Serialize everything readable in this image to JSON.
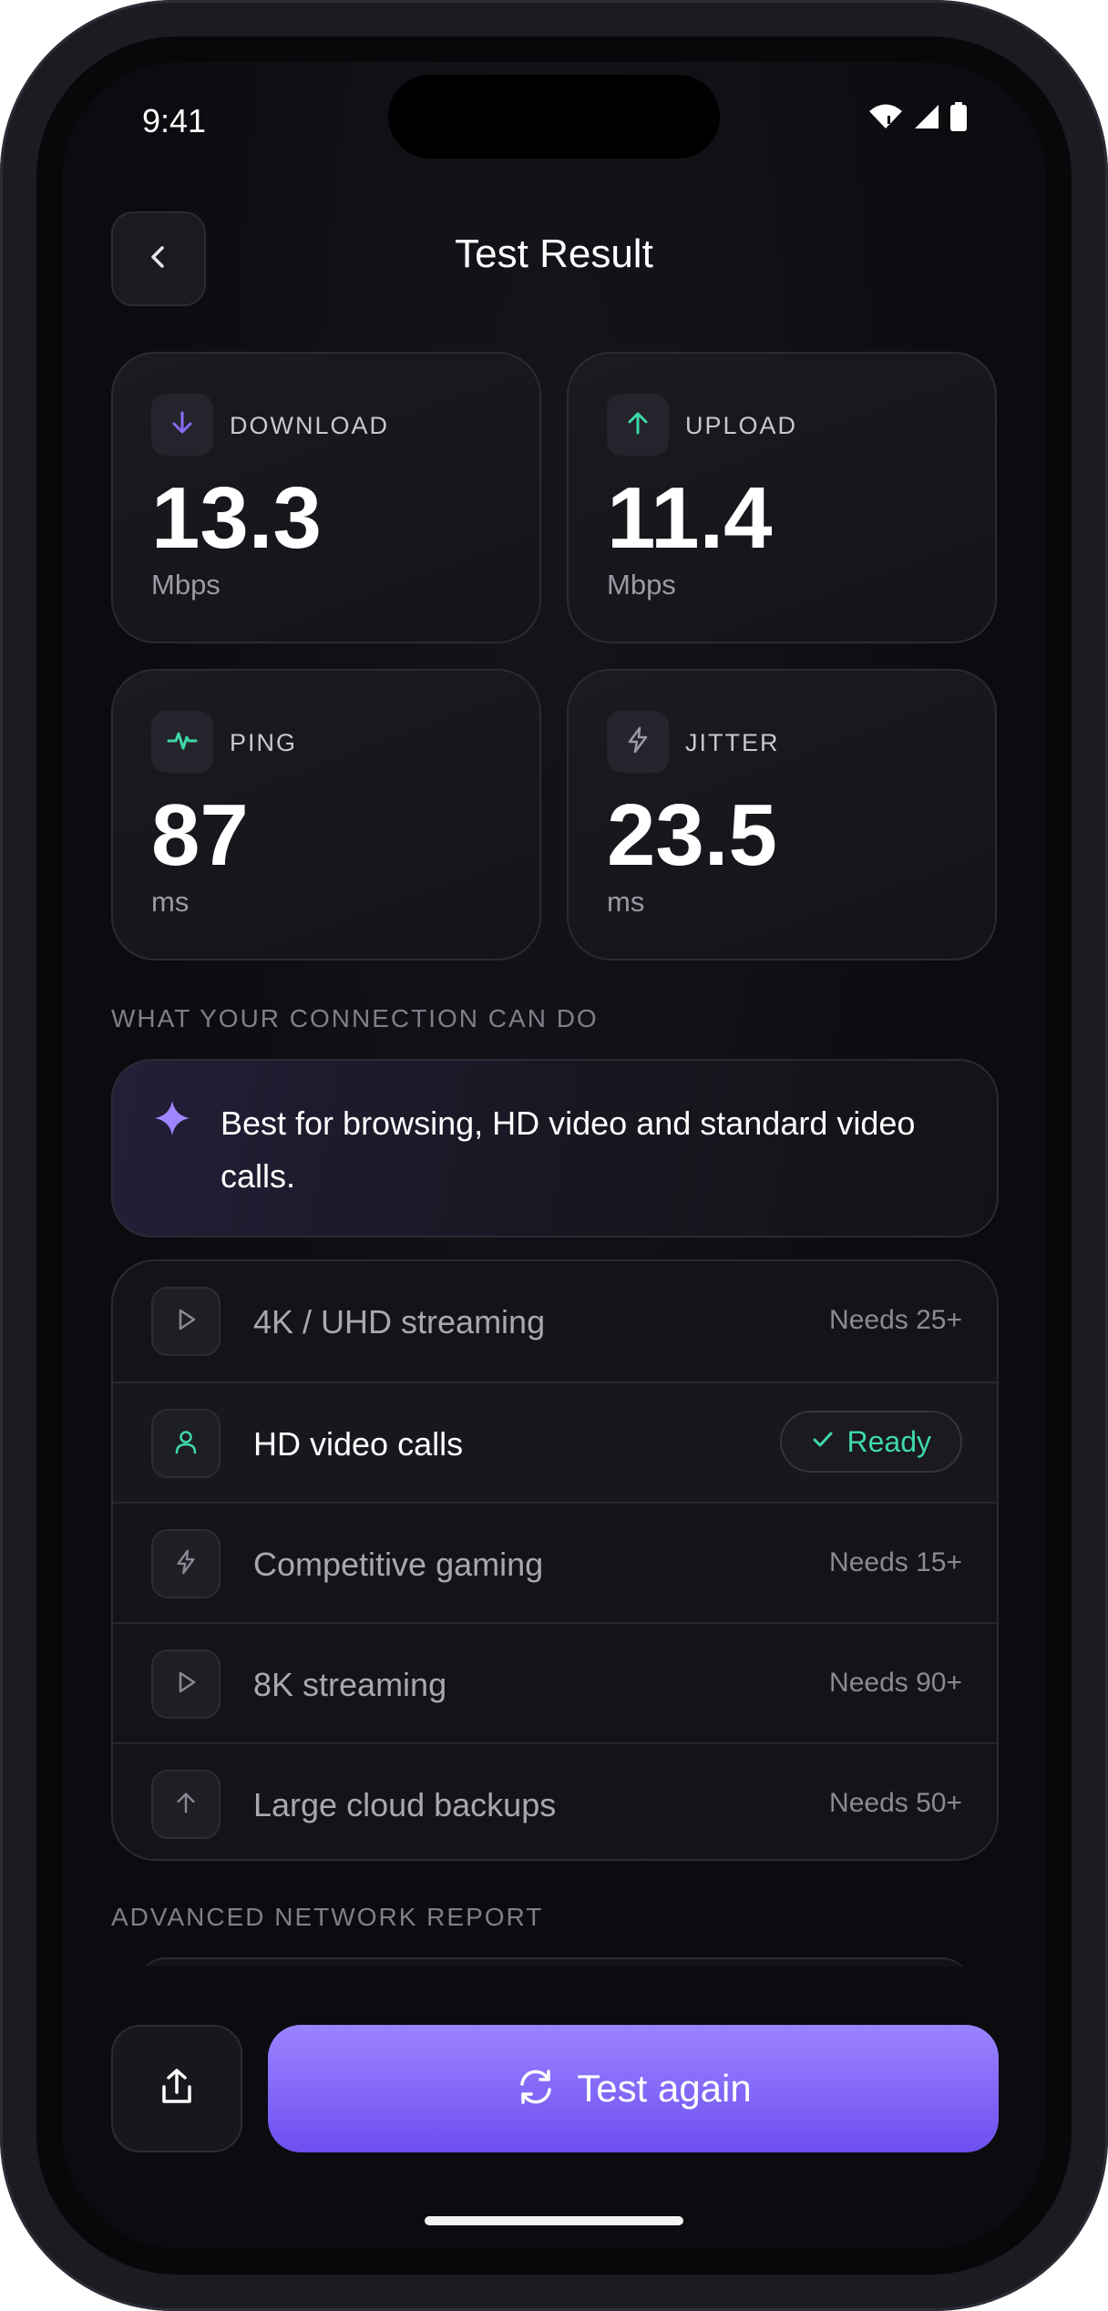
{
  "status_bar": {
    "time": "9:41"
  },
  "header": {
    "title": "Test Result"
  },
  "metrics": [
    {
      "label": "DOWNLOAD",
      "value": "13.3",
      "unit": "Mbps",
      "icon": "arrow-down-icon",
      "color": "#8b6cf6"
    },
    {
      "label": "UPLOAD",
      "value": "11.4",
      "unit": "Mbps",
      "icon": "arrow-up-icon",
      "color": "#3fd9a8"
    },
    {
      "label": "PING",
      "value": "87",
      "unit": "ms",
      "icon": "pulse-icon",
      "color": "#3fd9a8"
    },
    {
      "label": "JITTER",
      "value": "23.5",
      "unit": "ms",
      "icon": "bolt-icon",
      "color": "#9a9aa4"
    }
  ],
  "capabilities_section": {
    "title": "WHAT YOUR CONNECTION CAN DO",
    "summary": "Best for browsing, HD video and standard video calls."
  },
  "capabilities": [
    {
      "name": "4K / UHD streaming",
      "status": "Needs 25+",
      "icon": "play-icon"
    },
    {
      "name": "HD video calls",
      "status": "Ready",
      "icon": "user-icon"
    },
    {
      "name": "Competitive gaming",
      "status": "Needs 15+",
      "icon": "bolt-icon"
    },
    {
      "name": "8K streaming",
      "status": "Needs 90+",
      "icon": "play-icon"
    },
    {
      "name": "Large cloud backups",
      "status": "Needs 50+",
      "icon": "arrow-up-icon"
    }
  ],
  "report_section": {
    "title": "ADVANCED NETWORK REPORT"
  },
  "actions": {
    "test_again": "Test again"
  },
  "colors": {
    "accent": "#7c5cf5",
    "success": "#3fd9a8",
    "background": "#0c0c10"
  }
}
